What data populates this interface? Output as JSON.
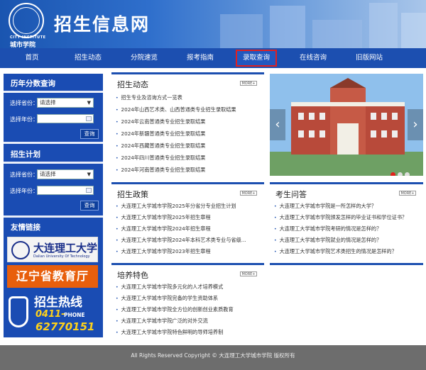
{
  "header": {
    "logo_en": "CITY INSTITUTE",
    "logo_cn": "城市学院",
    "title": "招生信息网"
  },
  "nav": [
    {
      "label": "首页"
    },
    {
      "label": "招生动态"
    },
    {
      "label": "分院速览"
    },
    {
      "label": "报考指南"
    },
    {
      "label": "录取查询",
      "active": true
    },
    {
      "label": "在线咨询"
    },
    {
      "label": "旧版网站"
    }
  ],
  "sidebar": {
    "history_title": "历年分数查询",
    "plan_title": "招生计划",
    "links_title": "友情链接",
    "province_label": "选择省份：",
    "year_label": "选择年份：",
    "province_placeholder": "请选择",
    "query_button": "查询",
    "link_dalian_cn": "大连理工大学",
    "link_dalian_en": "Dalian University Of Technology",
    "link_edu": "辽宁省教育厅",
    "hotline_title": "招生热线",
    "hotline_area": "0411-",
    "hotline_phone_word": "PHONE",
    "hotline_number": "62770151"
  },
  "news": {
    "title": "招生动态",
    "more": "MORE+",
    "items": [
      "招生专业及咨询方式一览表",
      "2024年山西艺术类、山西普通类专业招生录取结果",
      "2024年云南普通类专业招生录取结果",
      "2024年新疆普通类专业招生录取结果",
      "2024年西藏普通类专业招生录取结果",
      "2024年四川普通类专业招生录取结果",
      "2024年河南普通类专业招生录取结果"
    ]
  },
  "policy": {
    "title": "招生政策",
    "more": "MORE+",
    "items": [
      "大连理工大学城市学院2025年分省分专业招生计划",
      "大连理工大学城市学院2025年招生章程",
      "大连理工大学城市学院2024年招生章程",
      "大连理工大学城市学院2024年本科艺术类专业与省级...",
      "大连理工大学城市学院2023年招生章程"
    ]
  },
  "qa": {
    "title": "考生问答",
    "more": "MORE+",
    "items": [
      "大连理工大学城市学院是一所怎样的大学？",
      "大连理工大学城市学院颁发怎样的毕业证书和学位证书？",
      "大连理工大学城市学院考研的情况是怎样的？",
      "大连理工大学城市学院就业的情况是怎样的？",
      "大连理工大学城市学院艺术类招生的情况是怎样的？"
    ]
  },
  "training": {
    "title": "培养特色",
    "more": "MORE+",
    "items": [
      "大连理工大学城市学院多元化的人才培养模式",
      "大连理工大学城市学院完备的学生资助体系",
      "大连理工大学城市学院全方位的创新创业素质教育",
      "大连理工大学城市学院广泛的对外交流",
      "大连理工大学城市学院特色鲜明的导师培养制"
    ]
  },
  "slider": {
    "active_index": 0,
    "count": 3
  },
  "footer": {
    "text": "All Rights Reserved Copyright © 大连理工大学城市学院  版权所有"
  }
}
